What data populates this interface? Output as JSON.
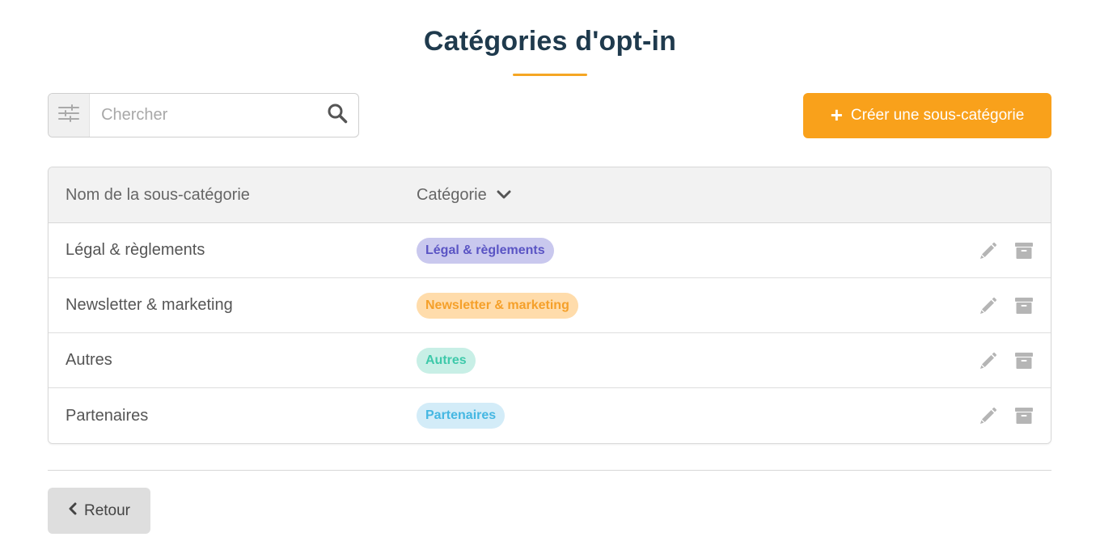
{
  "page": {
    "title": "Catégories d'opt-in",
    "accent_color": "#f9a11b",
    "title_color": "#1f3a4d"
  },
  "toolbar": {
    "filter_icon": "sliders-icon",
    "search_placeholder": "Chercher",
    "search_value": "",
    "search_icon": "magnifier-icon",
    "create_label": "Créer une sous-catégorie",
    "create_icon": "plus-icon"
  },
  "table": {
    "columns": [
      {
        "label": "Nom de la sous-catégorie"
      },
      {
        "label": "Catégorie",
        "icon": "chevron-down-icon"
      }
    ],
    "rows": [
      {
        "name": "Légal & règlements",
        "category": "Légal & règlements",
        "badge_bg": "#c9c8ee",
        "badge_fg": "#5a54c4"
      },
      {
        "name": "Newsletter & marketing",
        "category": "Newsletter & marketing",
        "badge_bg": "#ffdcab",
        "badge_fg": "#f5a02a"
      },
      {
        "name": "Autres",
        "category": "Autres",
        "badge_bg": "#c8efe6",
        "badge_fg": "#3ec9aa"
      },
      {
        "name": "Partenaires",
        "category": "Partenaires",
        "badge_bg": "#d3ecf8",
        "badge_fg": "#45b7e2"
      }
    ],
    "row_actions": [
      "pencil-icon",
      "archive-icon"
    ]
  },
  "footer": {
    "back_label": "Retour",
    "back_icon": "chevron-left-icon"
  }
}
